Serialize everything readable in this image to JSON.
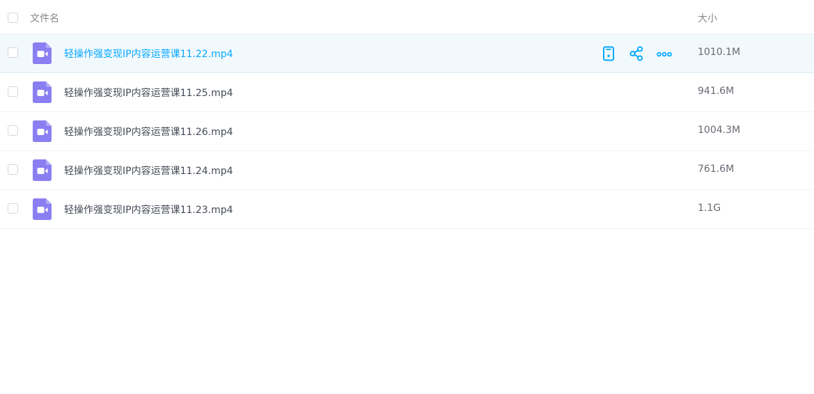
{
  "header": {
    "name_label": "文件名",
    "size_label": "大小"
  },
  "actions": {
    "icons": [
      "phone-icon",
      "share-icon",
      "more-icon"
    ],
    "accent_color": "#06a7ff"
  },
  "files": [
    {
      "name": "轻操作强变现IP内容运营课11.22.mp4",
      "size": "1010.1M",
      "icon": "video-file-icon",
      "hovered": true
    },
    {
      "name": "轻操作强变现IP内容运营课11.25.mp4",
      "size": "941.6M",
      "icon": "video-file-icon",
      "hovered": false
    },
    {
      "name": "轻操作强变现IP内容运营课11.26.mp4",
      "size": "1004.3M",
      "icon": "video-file-icon",
      "hovered": false
    },
    {
      "name": "轻操作强变现IP内容运营课11.24.mp4",
      "size": "761.6M",
      "icon": "video-file-icon",
      "hovered": false
    },
    {
      "name": "轻操作强变现IP内容运营课11.23.mp4",
      "size": "1.1G",
      "icon": "video-file-icon",
      "hovered": false
    }
  ],
  "colors": {
    "video_icon": "#8a7ff2",
    "hover_row_bg": "#f2f9fd",
    "text": "#444a55",
    "header_text": "#888888"
  }
}
